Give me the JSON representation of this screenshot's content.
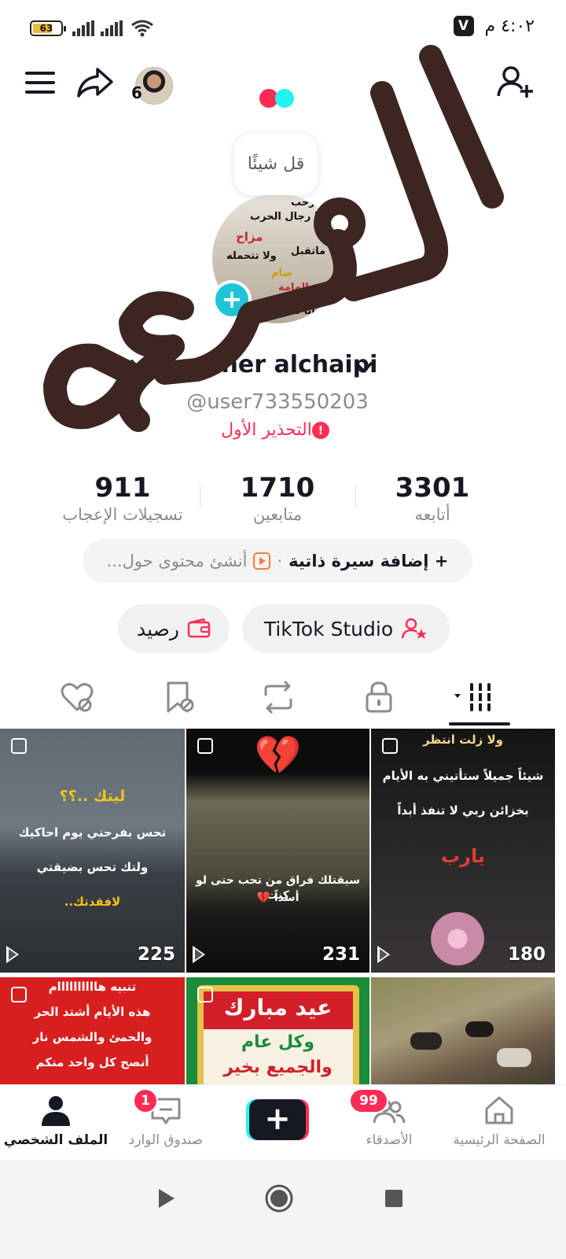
{
  "status_bar": {
    "battery_level": "63",
    "time": "٤:٠٢ م",
    "app_badge": "V"
  },
  "header": {
    "avatar_count": "6",
    "icons": [
      "menu-icon",
      "share-icon",
      "add-friend-icon"
    ]
  },
  "profile": {
    "say_something": "قل شيئًا",
    "display_name": "maher alchaipi",
    "username": "@user733550203",
    "warning": "التحذير الأول",
    "picture_texts": [
      "رحب",
      "احنا رجال الحرب",
      "مزاح",
      "ماتقبل",
      "ولا تتحمله",
      "صام",
      "الهامة",
      "موت",
      "ع جانا تقوم"
    ]
  },
  "stats": [
    {
      "value": "3301",
      "label": "أتابعه"
    },
    {
      "value": "1710",
      "label": "متابعين"
    },
    {
      "value": "911",
      "label": "تسجيلات الإعجاب"
    }
  ],
  "bio": {
    "add_label": "+ إضافة سيرة ذاتية",
    "separator": "·",
    "create_prompt": "أنشئ محتوى حول..."
  },
  "buttons": {
    "studio": "TikTok Studio",
    "balance": "رصيد"
  },
  "tabs": [
    "grid-tab-icon",
    "lock-tab-icon",
    "repost-tab-icon",
    "bookmark-tab-icon",
    "liked-tab-icon"
  ],
  "videos": [
    {
      "lines": [
        "ولا زلت انتظر",
        "شيئاً جميلاً ستأتيني به الأيام",
        "بخزائن ربي لا تنفذ أبداً",
        "يارب"
      ],
      "views": "180"
    },
    {
      "emoji": "💔",
      "lines": [
        "سيقتلك فراق من تحب حتى لو كنت",
        "أسداً 💔"
      ],
      "views": "231"
    },
    {
      "lines": [
        "ليتك ..؟؟",
        "تحس بفرحتي يوم احاكيك",
        "ولتك تحس بضيقتي",
        "لافقدتك.."
      ],
      "views": "225"
    },
    {
      "lines": [
        "تنبيه هاااااااااام",
        "هذه الأيام أشتد الحر",
        "والحمئ والشمس نار",
        "أنصح كل واحد منكم"
      ]
    },
    {
      "lines": [
        "عيد مبارك",
        "وكل عام",
        "والجميع بخير"
      ]
    },
    {
      "lines": []
    }
  ],
  "watermark": "الفزعه",
  "bottom_nav": [
    {
      "label": "الصفحة الرئيسية",
      "icon": "home-icon"
    },
    {
      "label": "الأصدقاء",
      "icon": "friends-icon",
      "badge": "99"
    },
    {
      "label": "",
      "icon": "create-icon"
    },
    {
      "label": "صندوق الوارد",
      "icon": "inbox-icon",
      "badge": "1"
    },
    {
      "label": "الملف الشخصي",
      "icon": "profile-icon"
    }
  ],
  "colors": {
    "accent": "#fe2c55",
    "cyan": "#25f4ee",
    "text": "#161823",
    "muted": "#8a8b91",
    "watermark": "#3d2621"
  }
}
